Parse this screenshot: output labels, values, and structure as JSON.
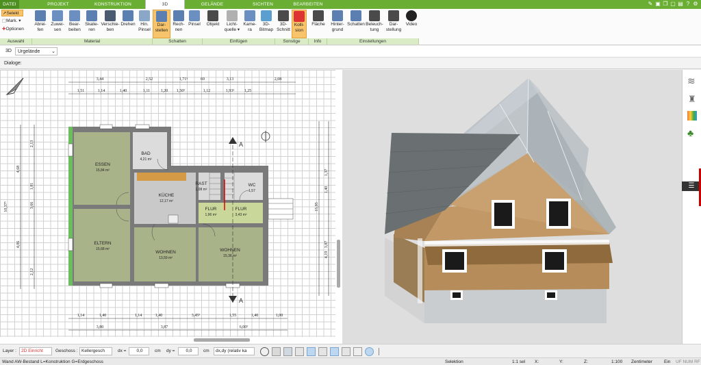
{
  "tabs": [
    "DATEI",
    "PROJEKT",
    "KONSTRUKTION",
    "3D",
    "GELÄNDE",
    "SICHTEN",
    "BEARBEITEN"
  ],
  "ribbon": {
    "auswahl": {
      "select": "Selekt",
      "mark": "Mark.",
      "options": "Optionen",
      "group": "Auswahl"
    },
    "material": {
      "buttons": [
        "Abrei-\nfen",
        "Zuwei-\nsen",
        "Bear-\nbeiten",
        "Skalie-\nren",
        "Verschie-\nben",
        "Drehen",
        "Hin.\nPinsel"
      ],
      "group": "Material"
    },
    "schatten": {
      "buttons": [
        "Dar-\nstellen",
        "Rech-\nnen",
        "Pinsel"
      ],
      "group": "Schatten"
    },
    "einfuegen": {
      "buttons": [
        "Objekt",
        "Licht-\nquelle ▾",
        "Kame-\nra",
        "3D-\nBitmap"
      ],
      "group": "Einfügen"
    },
    "sonstige": {
      "buttons": [
        "3D-\nSchnitt",
        "Kolli-\nsion"
      ],
      "group": "Sonstige"
    },
    "info": {
      "buttons": [
        "Fläche"
      ],
      "group": "Info"
    },
    "einstellungen": {
      "buttons": [
        "Hinter-\ngrund",
        "Schatten",
        "Beleuch-\ntung",
        "Dar-\nstellung",
        "Video"
      ],
      "group": "Einstellungen"
    }
  },
  "bar3d": {
    "label": "3D",
    "value": "Urgelände"
  },
  "dialog": {
    "label": "Dialoge:"
  },
  "plan": {
    "rooms": [
      {
        "name": "ESSEN",
        "area": "15,84 m²"
      },
      {
        "name": "BAD",
        "area": "4,21 m²"
      },
      {
        "name": "KÜCHE",
        "area": "12,17 m²"
      },
      {
        "name": "FLUR",
        "area": "1,96 m²"
      },
      {
        "name": "FLUR",
        "area": "3,43 m²"
      },
      {
        "name": "ELTERN",
        "area": "15,68 m²"
      },
      {
        "name": "WOHNEN",
        "area": "13,59 m²"
      },
      {
        "name": "WOHNEN",
        "area": "15,36 m²"
      },
      {
        "name": "WC",
        "area": "1,57"
      },
      {
        "name": "RAST",
        "area": "1,08 m²"
      }
    ],
    "dims_top1": [
      "3,44",
      "2,52",
      "1,71⁵",
      "69",
      "3,13",
      "2,08"
    ],
    "dims_top2": [
      "1,51",
      "1,14",
      "1,40",
      "1,11",
      "1,20",
      "1,50⁵",
      "1,12",
      "1,93⁵",
      "1,25"
    ],
    "dims_bottom1": [
      "1,14",
      "1,40",
      "1,14",
      "1,40",
      "3,45⁵",
      "1,55",
      "1,40",
      "1,00"
    ],
    "dims_bottom2": [
      "3,80",
      "3,87",
      "6,00⁵"
    ],
    "dims_left": [
      "2,13",
      "4,68",
      "1,81",
      "3,66",
      "4,06",
      "2,12",
      "10,37⁵"
    ],
    "dims_right": [
      "1,37",
      "1,40",
      "3,87",
      "15,95",
      "4,19"
    ],
    "section": "A"
  },
  "toolbar": {
    "layer_label": "Layer :",
    "layer_value": "2D Einricht",
    "geschoss_label": "Geschoss :",
    "geschoss_value": "Kellergesch",
    "dx_label": "dx =",
    "dx_value": "0,0",
    "dx_unit": "cm",
    "dy_label": "dy =",
    "dy_value": "0,0",
    "dy_unit": "cm",
    "mode_value": "dx,dy (relativ ka"
  },
  "status": {
    "left": "Wand AW-Bestand L=Konstruktion G=Erdgeschoss",
    "mode": "Selektion",
    "sel": "1:1 sel",
    "x": "X:",
    "y": "Y:",
    "z": "Z:",
    "scale": "1:100",
    "unit": "Zentimeter",
    "ein": "Ein",
    "flags": "UF NUM RF"
  },
  "colors": {
    "green": "#6aae33",
    "ribbonGroup": "#d9ecc6",
    "active": "#f7c36b",
    "wall": "#7a7a7a",
    "room": "#a9b38a",
    "roof": "#6a7072"
  }
}
